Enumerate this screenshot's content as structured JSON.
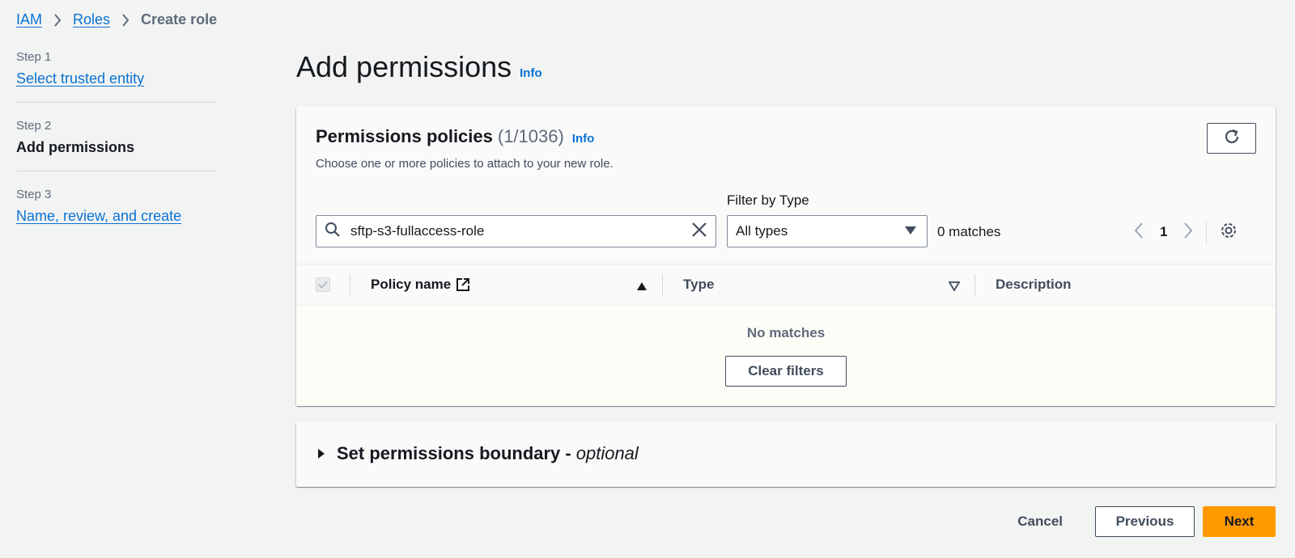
{
  "breadcrumb": {
    "items": [
      "IAM",
      "Roles"
    ],
    "current": "Create role"
  },
  "steps": [
    {
      "num": "Step 1",
      "label": "Select trusted entity"
    },
    {
      "num": "Step 2",
      "label": "Add permissions"
    },
    {
      "num": "Step 3",
      "label": "Name, review, and create"
    }
  ],
  "page": {
    "title": "Add permissions",
    "info": "Info"
  },
  "policies": {
    "title": "Permissions policies",
    "count": "(1/1036)",
    "info": "Info",
    "description": "Choose one or more policies to attach to your new role.",
    "search_value": "sftp-s3-fullaccess-role",
    "filter_label": "Filter by Type",
    "filter_value": "All types",
    "matches": "0 matches",
    "page_number": "1",
    "columns": [
      "Policy name",
      "Type",
      "Description"
    ],
    "empty_text": "No matches",
    "clear_filters": "Clear filters"
  },
  "boundary": {
    "title": "Set permissions boundary -",
    "optional": "optional"
  },
  "actions": {
    "cancel": "Cancel",
    "previous": "Previous",
    "next": "Next"
  },
  "colors": {
    "accent": "#0972d3",
    "primary_button": "#ff9900",
    "background": "#f2f3f3"
  }
}
